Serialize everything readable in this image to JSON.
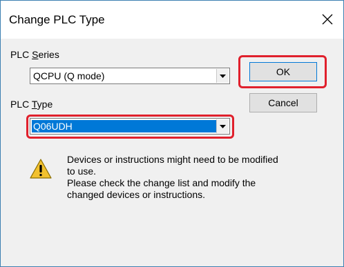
{
  "window": {
    "title": "Change PLC Type"
  },
  "plc_series": {
    "label_pre": "PLC ",
    "label_accel": "S",
    "label_post": "eries",
    "value": "QCPU (Q mode)"
  },
  "plc_type": {
    "label_pre": "PLC ",
    "label_accel": "T",
    "label_post": "ype",
    "value": "Q06UDH"
  },
  "buttons": {
    "ok": "OK",
    "cancel": "Cancel"
  },
  "message": {
    "lines": [
      "Devices or instructions might need to be modified",
      "to use.",
      "Please check the change list and modify the",
      "changed devices or instructions."
    ]
  },
  "icons": {
    "close": "close-icon",
    "warning": "warning-icon",
    "dropdown": "chevron-down-icon"
  },
  "colors": {
    "highlight": "#e0202c",
    "selection": "#0078d7",
    "warning_fill": "#f2c12e"
  }
}
